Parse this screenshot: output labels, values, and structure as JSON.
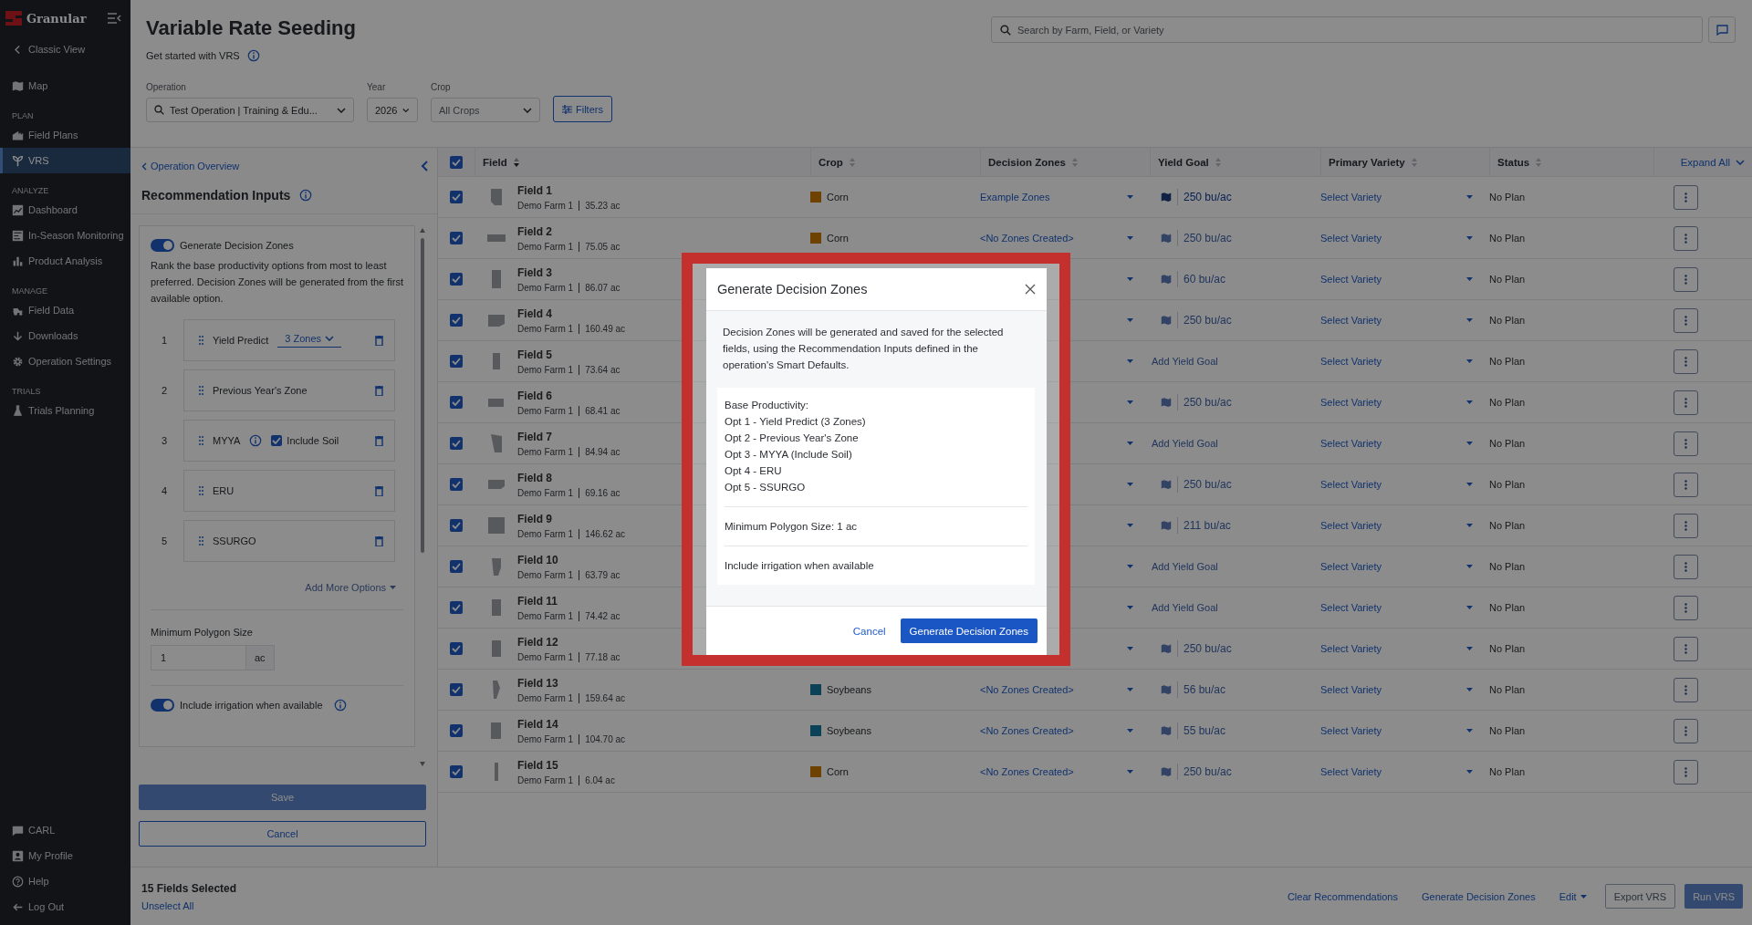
{
  "sidebar": {
    "brand": "Granular",
    "top_items": [
      {
        "label": "Classic View",
        "selected": false
      },
      {
        "label": "Map",
        "selected": false
      }
    ],
    "sections": [
      {
        "heading": "PLAN",
        "items": [
          {
            "label": "Field Plans",
            "selected": false
          },
          {
            "label": "VRS",
            "selected": true
          }
        ]
      },
      {
        "heading": "ANALYZE",
        "items": [
          {
            "label": "Dashboard",
            "selected": false
          },
          {
            "label": "In-Season Monitoring",
            "selected": false
          },
          {
            "label": "Product Analysis",
            "selected": false
          }
        ]
      },
      {
        "heading": "MANAGE",
        "items": [
          {
            "label": "Field Data",
            "selected": false
          },
          {
            "label": "Downloads",
            "selected": false
          },
          {
            "label": "Operation Settings",
            "selected": false
          }
        ]
      },
      {
        "heading": "TRIALS",
        "items": [
          {
            "label": "Trials Planning",
            "selected": false
          }
        ]
      }
    ],
    "bottom_items": [
      {
        "label": "CARL",
        "selected": false
      },
      {
        "label": "My Profile",
        "selected": false
      },
      {
        "label": "Help",
        "selected": false
      },
      {
        "label": "Log Out",
        "selected": false
      }
    ]
  },
  "header": {
    "title": "Variable Rate Seeding",
    "subtitle": "Get started with VRS",
    "search": {
      "placeholder": "Search by Farm, Field, or Variety"
    }
  },
  "filters": [
    {
      "label": "Operation",
      "value": "Test Operation | Training & Edu...",
      "kind": "search"
    },
    {
      "label": "Year",
      "value": "2026",
      "kind": "select"
    },
    {
      "label": "Crop",
      "placeholder": "All Crops",
      "kind": "select"
    }
  ],
  "filters_button": "Filters",
  "panel": {
    "back_link": "Operation Overview",
    "heading": "Recommendation Inputs",
    "generate_toggle": {
      "label": "Generate Decision Zones",
      "on": true
    },
    "description": "Rank the base productivity options from most to least preferred. Decision Zones will be generated from the first available option.",
    "options": [
      {
        "rank": "1",
        "name": "Yield Predict",
        "zones": "3 Zones"
      },
      {
        "rank": "2",
        "name": "Previous Year's Zone"
      },
      {
        "rank": "3",
        "name": "MYYA",
        "include_soil": {
          "label": "Include Soil",
          "checked": true
        }
      },
      {
        "rank": "4",
        "name": "ERU"
      },
      {
        "rank": "5",
        "name": "SSURGO"
      }
    ],
    "add_more": "Add More Options",
    "min_polygon": {
      "label": "Minimum Polygon Size",
      "value": "1",
      "unit": "ac"
    },
    "irrigation_toggle": {
      "label": "Include irrigation when available",
      "on": true
    },
    "save": {
      "label": "Save",
      "disabled": true
    },
    "cancel": "Cancel"
  },
  "table": {
    "all_checked": true,
    "expand_all": "Expand All",
    "columns": [
      {
        "label": "Field",
        "sorted": true
      },
      {
        "label": "Crop",
        "sorted": false
      },
      {
        "label": "Decision Zones",
        "sorted": false
      },
      {
        "label": "Yield Goal",
        "sorted": false
      },
      {
        "label": "Primary Variety",
        "sorted": false
      },
      {
        "label": "Status",
        "sorted": false
      }
    ],
    "rows": [
      {
        "checked": true,
        "name": "Field 1",
        "farm": "Demo Farm 1",
        "area": "35.23 ac",
        "crop": {
          "name": "Corn",
          "color": "#6e4200"
        },
        "zones": "Example Zones",
        "yield_goal": {
          "kind": "value",
          "text": "250 bu/ac",
          "muted": false
        },
        "variety": "Select Variety",
        "status": "No Plan"
      },
      {
        "checked": true,
        "name": "Field 2",
        "farm": "Demo Farm 1",
        "area": "75.05 ac",
        "crop": {
          "name": "Corn",
          "color": "#6e4200"
        },
        "zones": "<No Zones Created>",
        "yield_goal": {
          "kind": "value",
          "text": "250 bu/ac",
          "muted": true
        },
        "variety": "Select Variety",
        "status": "No Plan"
      },
      {
        "checked": true,
        "name": "Field 3",
        "farm": "Demo Farm 1",
        "area": "86.07 ac",
        "yield_goal": {
          "kind": "value",
          "text": "60 bu/ac",
          "muted": true
        },
        "variety": "Select Variety",
        "status": "No Plan"
      },
      {
        "checked": true,
        "name": "Field 4",
        "farm": "Demo Farm 1",
        "area": "160.49 ac",
        "yield_goal": {
          "kind": "value",
          "text": "250 bu/ac",
          "muted": true
        },
        "variety": "Select Variety",
        "status": "No Plan"
      },
      {
        "checked": true,
        "name": "Field 5",
        "farm": "Demo Farm 1",
        "area": "73.64 ac",
        "yield_goal": {
          "kind": "add",
          "text": "Add Yield Goal",
          "muted": true
        },
        "variety": "Select Variety",
        "status": "No Plan"
      },
      {
        "checked": true,
        "name": "Field 6",
        "farm": "Demo Farm 1",
        "area": "68.41 ac",
        "yield_goal": {
          "kind": "value",
          "text": "250 bu/ac",
          "muted": true
        },
        "variety": "Select Variety",
        "status": "No Plan"
      },
      {
        "checked": true,
        "name": "Field 7",
        "farm": "Demo Farm 1",
        "area": "84.94 ac",
        "yield_goal": {
          "kind": "add",
          "text": "Add Yield Goal",
          "muted": true
        },
        "variety": "Select Variety",
        "status": "No Plan"
      },
      {
        "checked": true,
        "name": "Field 8",
        "farm": "Demo Farm 1",
        "area": "69.16 ac",
        "yield_goal": {
          "kind": "value",
          "text": "250 bu/ac",
          "muted": true
        },
        "variety": "Select Variety",
        "status": "No Plan"
      },
      {
        "checked": true,
        "name": "Field 9",
        "farm": "Demo Farm 1",
        "area": "146.62 ac",
        "yield_goal": {
          "kind": "value",
          "text": "211 bu/ac",
          "muted": true
        },
        "variety": "Select Variety",
        "status": "No Plan"
      },
      {
        "checked": true,
        "name": "Field 10",
        "farm": "Demo Farm 1",
        "area": "63.79 ac",
        "yield_goal": {
          "kind": "add",
          "text": "Add Yield Goal",
          "muted": true
        },
        "variety": "Select Variety",
        "status": "No Plan"
      },
      {
        "checked": true,
        "name": "Field 11",
        "farm": "Demo Farm 1",
        "area": "74.42 ac",
        "yield_goal": {
          "kind": "add",
          "text": "Add Yield Goal",
          "muted": true
        },
        "variety": "Select Variety",
        "status": "No Plan"
      },
      {
        "checked": true,
        "name": "Field 12",
        "farm": "Demo Farm 1",
        "area": "77.18 ac",
        "yield_goal": {
          "kind": "value",
          "text": "250 bu/ac",
          "muted": true
        },
        "variety": "Select Variety",
        "status": "No Plan"
      },
      {
        "checked": true,
        "name": "Field 13",
        "farm": "Demo Farm 1",
        "area": "159.64 ac",
        "crop": {
          "name": "Soybeans",
          "color": "#0b4258"
        },
        "zones": "<No Zones Created>",
        "yield_goal": {
          "kind": "value",
          "text": "56 bu/ac",
          "muted": true
        },
        "variety": "Select Variety",
        "status": "No Plan"
      },
      {
        "checked": true,
        "name": "Field 14",
        "farm": "Demo Farm 1",
        "area": "104.70 ac",
        "crop": {
          "name": "Soybeans",
          "color": "#0b4258"
        },
        "zones": "<No Zones Created>",
        "yield_goal": {
          "kind": "value",
          "text": "55 bu/ac",
          "muted": true
        },
        "variety": "Select Variety",
        "status": "No Plan"
      },
      {
        "checked": true,
        "name": "Field 15",
        "farm": "Demo Farm 1",
        "area": "6.04 ac",
        "crop": {
          "name": "Corn",
          "color": "#6e4200"
        },
        "zones": "<No Zones Created>",
        "yield_goal": {
          "kind": "value",
          "text": "250 bu/ac",
          "muted": true
        },
        "variety": "Select Variety",
        "status": "No Plan"
      }
    ]
  },
  "footer": {
    "selected_count": "15 Fields Selected",
    "unselect": "Unselect All",
    "actions": [
      {
        "kind": "link",
        "label": "Clear Recommendations",
        "disabled": false
      },
      {
        "kind": "link",
        "label": "Generate Decision Zones",
        "disabled": false
      },
      {
        "kind": "menu",
        "label": "Edit",
        "disabled": false
      },
      {
        "kind": "secondary",
        "label": "Export VRS",
        "disabled": true
      },
      {
        "kind": "primary",
        "label": "Run VRS",
        "disabled": true
      }
    ]
  },
  "modal": {
    "title": "Generate Decision Zones",
    "body": "Decision Zones will be generated and saved for the selected fields, using the Recommendation Inputs defined in the operation's Smart Defaults.",
    "summary": {
      "heading": "Base Productivity:",
      "lines": [
        "Opt 1 - Yield Predict (3 Zones)",
        "Opt 2 - Previous Year's Zone",
        "Opt 3 - MYYA (Include Soil)",
        "Opt 4 - ERU",
        "Opt 5 - SSURGO"
      ],
      "min_polygon": "Minimum Polygon Size: 1 ac",
      "irrigation": "Include irrigation when available"
    },
    "cancel": "Cancel",
    "confirm": "Generate Decision Zones"
  }
}
